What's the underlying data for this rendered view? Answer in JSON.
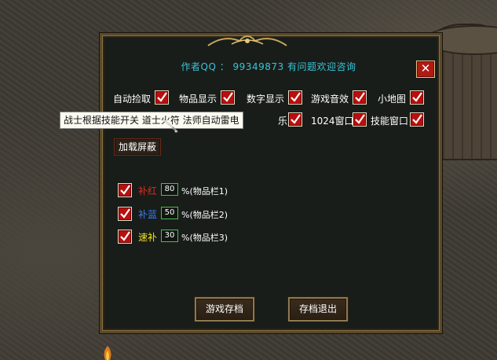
{
  "header": {
    "author_text": "作者QQ ： 99349873 有问题欢迎咨询",
    "close_symbol": "✕"
  },
  "options_row1": [
    {
      "label": "自动捡取",
      "checked": true
    },
    {
      "label": "物品显示",
      "checked": true
    },
    {
      "label": "数字显示",
      "checked": true
    },
    {
      "label": "游戏音效",
      "checked": true
    },
    {
      "label": "小地图",
      "checked": true
    }
  ],
  "options_row2": [
    {
      "label": "1024窗口",
      "checked": true
    },
    {
      "label": "技能窗口",
      "checked": true
    }
  ],
  "tooltip": {
    "text": "战士根据技能开关 道士火符 法师自动雷电"
  },
  "row2_partial": {
    "text": "乐"
  },
  "load_button": {
    "label": "加载屏蔽"
  },
  "recovery": [
    {
      "label": "补红",
      "value": "80",
      "suffix": "%(物品栏1)",
      "color": "#e02a1e",
      "checked": true
    },
    {
      "label": "补蓝",
      "value": "50",
      "suffix": "%(物品栏2)",
      "color": "#3a7cf0",
      "checked": true
    },
    {
      "label": "速补",
      "value": "30",
      "suffix": "%(物品栏3)",
      "color": "#f0e01e",
      "checked": true
    }
  ],
  "buttons": {
    "save": "游戏存档",
    "save_exit": "存档退出"
  },
  "colors": {
    "accent_cyan": "#39c4d6",
    "checkbox_red": "#b90f0f",
    "frame_gold": "#8e7a52"
  }
}
